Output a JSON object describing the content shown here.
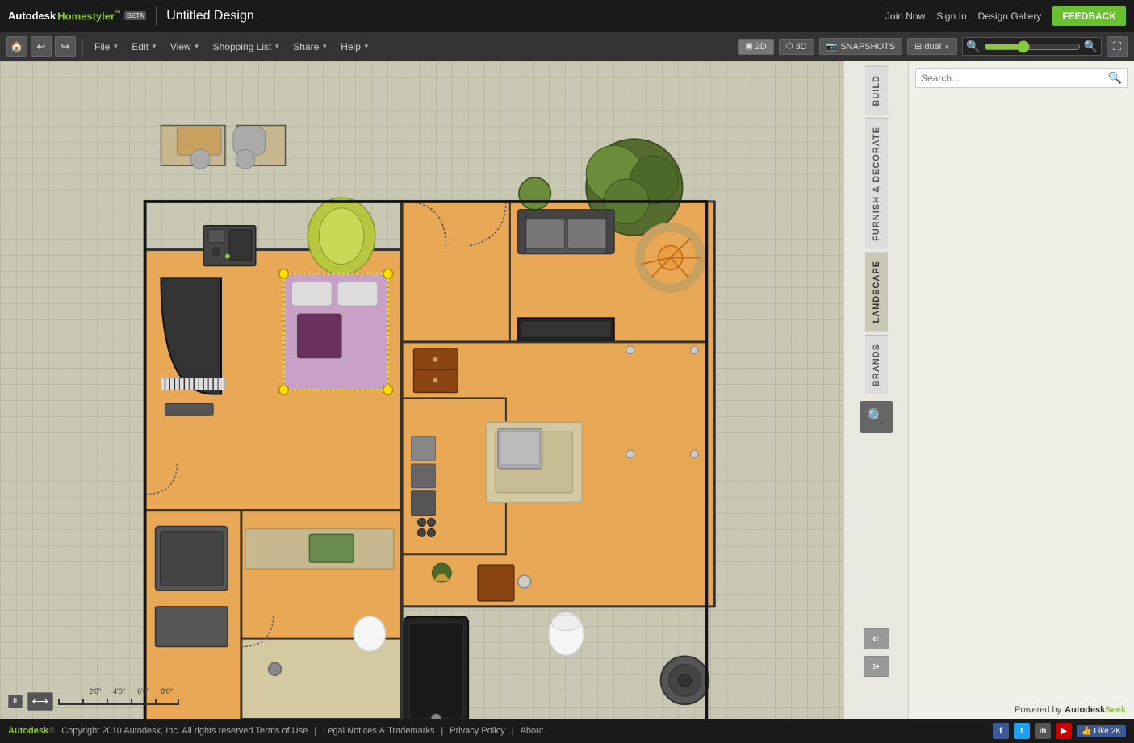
{
  "app": {
    "name": "Autodesk",
    "product": "Homestyler",
    "tm": "™",
    "beta": "BETA",
    "title": "Untitled Design",
    "feedback_label": "FEEDBACK"
  },
  "topnav": {
    "join_now": "Join Now",
    "sign_in": "Sign In",
    "design_gallery": "Design Gallery"
  },
  "toolbar": {
    "file_label": "File",
    "edit_label": "Edit",
    "view_label": "View",
    "shopping_list_label": "Shopping List",
    "share_label": "Share",
    "help_label": "Help",
    "view_2d": "2D",
    "view_3d": "3D",
    "snapshots": "SNAPSHOTS",
    "dual": "dual"
  },
  "right_panel": {
    "build_tab": "BUILD",
    "furnish_tab": "FURNISH & DECORATE",
    "landscape_tab": "LANDSCAPE",
    "brands_tab": "BRANDS",
    "search_placeholder": "Search..."
  },
  "scale": {
    "unit": "ft",
    "marks": [
      "2'0\"",
      "4'0\"",
      "6'0\"",
      "8'0\""
    ]
  },
  "bottom_bar": {
    "copyright": "Copyright 2010 Autodesk, Inc. All rights reserved.",
    "terms": "Terms of Use",
    "legal": "Legal Notices & Trademarks",
    "privacy": "Privacy Policy",
    "about": "About",
    "powered_by": "Powered by",
    "autodesk_seek": "Autodesk Seek",
    "like_label": "Like",
    "like_count": "2K"
  }
}
